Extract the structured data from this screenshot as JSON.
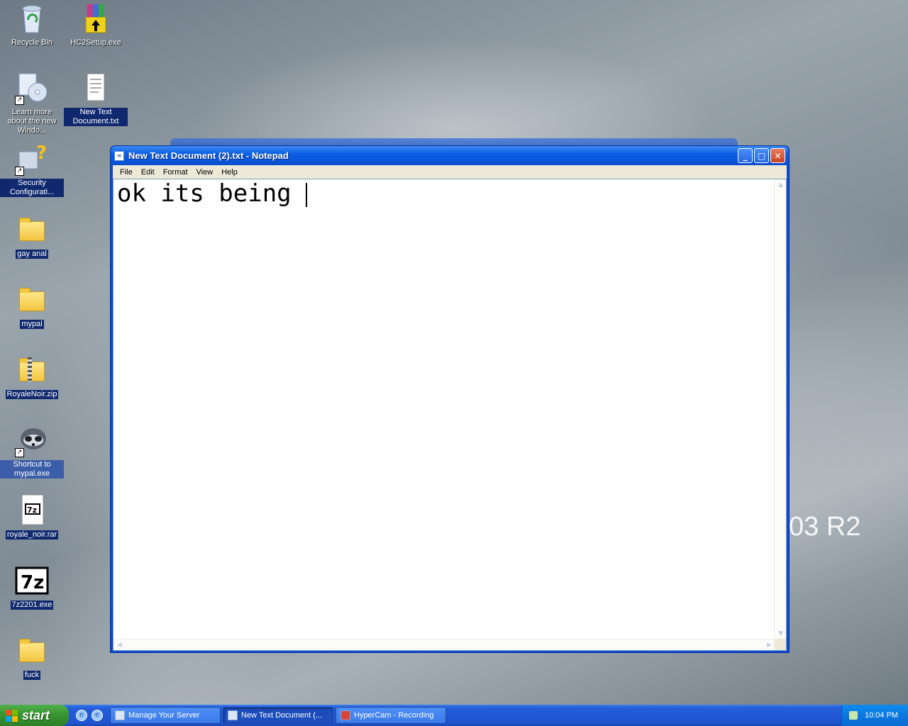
{
  "desktop": {
    "watermark": "03 R2",
    "icons": [
      {
        "label": "Recycle Bin"
      },
      {
        "label": "HC2Setup.exe"
      },
      {
        "label": "Learn more about the new Windo..."
      },
      {
        "label": "New Text Document.txt"
      },
      {
        "label": "Security Configurati..."
      },
      {
        "label": "gay anal"
      },
      {
        "label": "mypal"
      },
      {
        "label": "RoyaleNoir.zip"
      },
      {
        "label": "Shortcut to mypal.exe"
      },
      {
        "label": "royale_noir.rar"
      },
      {
        "label": "7z2201.exe"
      },
      {
        "label": "fuck"
      }
    ],
    "icon_images": {
      "sevenzip_small": "7z",
      "sevenzip_big": "7z"
    }
  },
  "notepad": {
    "title": "New Text Document (2).txt - Notepad",
    "menu": [
      "File",
      "Edit",
      "Format",
      "View",
      "Help"
    ],
    "content": "ok its being "
  },
  "taskbar": {
    "start_label": "start",
    "tasks": [
      {
        "label": "Manage Your Server"
      },
      {
        "label": "New Text Document (..."
      },
      {
        "label": "HyperCam - Recording"
      }
    ],
    "clock": "10:04 PM"
  }
}
